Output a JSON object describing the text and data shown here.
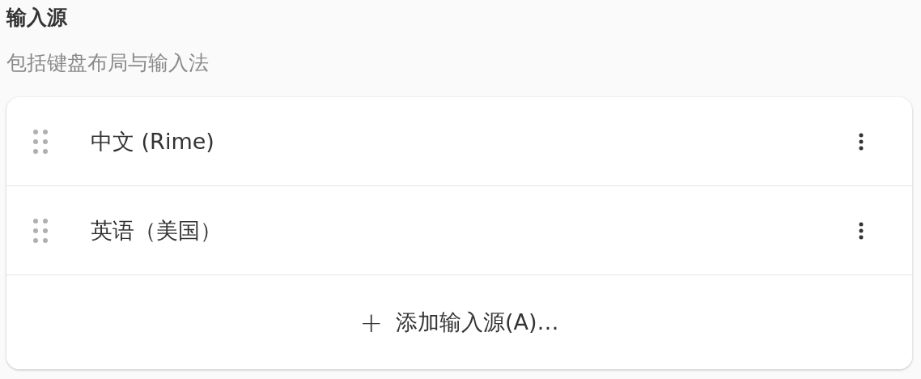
{
  "section": {
    "title": "输入源",
    "subtitle": "包括键盘布局与输入法"
  },
  "sources": [
    {
      "name": "中文 (Rime)"
    },
    {
      "name": "英语（美国）"
    }
  ],
  "add_button": {
    "icon": "+",
    "label": "添加输入源(A)…"
  }
}
